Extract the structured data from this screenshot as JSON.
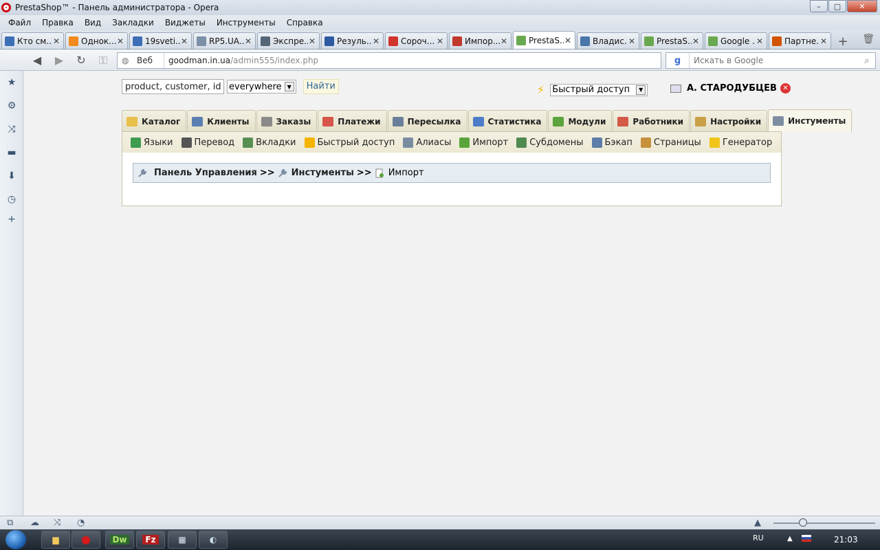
{
  "window": {
    "title": "PrestaShop™ - Панель администратора - Opera",
    "buttons": {
      "minimize": "–",
      "maximize": "▢",
      "close": "✕"
    }
  },
  "menu": [
    "Файл",
    "Правка",
    "Вид",
    "Закладки",
    "Виджеты",
    "Инструменты",
    "Справка"
  ],
  "tabs": [
    {
      "label": "Кто см...",
      "icon": "at-icon",
      "color": "#3d6fb6"
    },
    {
      "label": "Однок...",
      "icon": "odnoklassniki-icon",
      "color": "#f08a1d"
    },
    {
      "label": "19sveti...",
      "icon": "at-icon",
      "color": "#3d6fb6"
    },
    {
      "label": "RP5.UA...",
      "icon": "weather-icon",
      "color": "#7b8fa6"
    },
    {
      "label": "Экспре...",
      "icon": "speed-dial-icon",
      "color": "#556677"
    },
    {
      "label": "Резуль...",
      "icon": "j-icon",
      "color": "#2c5aa0"
    },
    {
      "label": "Сороч...",
      "icon": "shop-icon",
      "color": "#d0342c"
    },
    {
      "label": "Импор...",
      "icon": "import-icon",
      "color": "#c0392b"
    },
    {
      "label": "PrestaS...",
      "icon": "presta-icon",
      "color": "#6aa84f"
    },
    {
      "label": "Владис...",
      "icon": "vk-icon",
      "color": "#4a76a8"
    },
    {
      "label": "PrestaS...",
      "icon": "presta-icon",
      "color": "#6aa84f"
    },
    {
      "label": "Google ...",
      "icon": "presta-icon",
      "color": "#6aa84f"
    },
    {
      "label": "Партне...",
      "icon": "search-icon",
      "color": "#d35400"
    }
  ],
  "active_tab_index": 8,
  "address": {
    "scheme_label": "Веб",
    "url_host": "goodman.in.ua",
    "url_path": "/admin555/index.php",
    "search_placeholder": "Искать в Google",
    "search_engine": "g"
  },
  "admin": {
    "search_value": "product, customer, id...",
    "scope_select": "everywhere",
    "search_button": "Найти",
    "quick_access": "Быстрый доступ",
    "user_name": "А. СТАРОДУБЦЕВ",
    "tabs": [
      {
        "label": "Каталог",
        "icon": "folder-icon",
        "color": "#e8c04a"
      },
      {
        "label": "Клиенты",
        "icon": "user-icon",
        "color": "#5b7fb0"
      },
      {
        "label": "Заказы",
        "icon": "cart-icon",
        "color": "#8a8a8a"
      },
      {
        "label": "Платежи",
        "icon": "payment-icon",
        "color": "#d6544a"
      },
      {
        "label": "Пересылка",
        "icon": "truck-icon",
        "color": "#6a7f99"
      },
      {
        "label": "Статистика",
        "icon": "chart-icon",
        "color": "#4d7cc9"
      },
      {
        "label": "Модули",
        "icon": "puzzle-icon",
        "color": "#5aa43b"
      },
      {
        "label": "Работники",
        "icon": "employee-icon",
        "color": "#d25a47"
      },
      {
        "label": "Настройки",
        "icon": "settings-icon",
        "color": "#c9a048"
      },
      {
        "label": "Инстументы",
        "icon": "wrench-icon",
        "color": "#7d8ea3"
      }
    ],
    "active_tab_index": 9,
    "subnav": [
      {
        "label": "Языки",
        "icon": "globe-icon",
        "color": "#3f9b4f"
      },
      {
        "label": "Перевод",
        "icon": "text-icon",
        "color": "#555555"
      },
      {
        "label": "Вкладки",
        "icon": "tabs-icon",
        "color": "#5a8f52"
      },
      {
        "label": "Быстрый доступ",
        "icon": "lightning-icon",
        "color": "#f4b400"
      },
      {
        "label": "Алиасы",
        "icon": "magnifier-icon",
        "color": "#7a8ca0"
      },
      {
        "label": "Импорт",
        "icon": "import-icon",
        "color": "#5aa43b"
      },
      {
        "label": "Субдомены",
        "icon": "subdomain-icon",
        "color": "#4f8a4f"
      },
      {
        "label": "Бэкап",
        "icon": "backup-icon",
        "color": "#5d7da8"
      },
      {
        "label": "Страницы",
        "icon": "pages-icon",
        "color": "#c8903a"
      },
      {
        "label": "Генератор",
        "icon": "bulb-icon",
        "color": "#f0c419"
      }
    ],
    "breadcrumb": {
      "root": "Панель Управления",
      "section": "Инстументы",
      "current": "Импорт",
      "separator": ">>"
    }
  },
  "taskbar": {
    "apps": [
      {
        "label": "",
        "icon": "explorer-icon"
      },
      {
        "label": "",
        "icon": "opera-icon"
      },
      {
        "label": "Dw",
        "icon": "dreamweaver-icon"
      },
      {
        "label": "",
        "icon": "filezilla-icon"
      },
      {
        "label": "",
        "icon": "calculator-icon"
      },
      {
        "label": "",
        "icon": "paint-icon"
      }
    ],
    "language": "RU",
    "clock": "21:03"
  }
}
